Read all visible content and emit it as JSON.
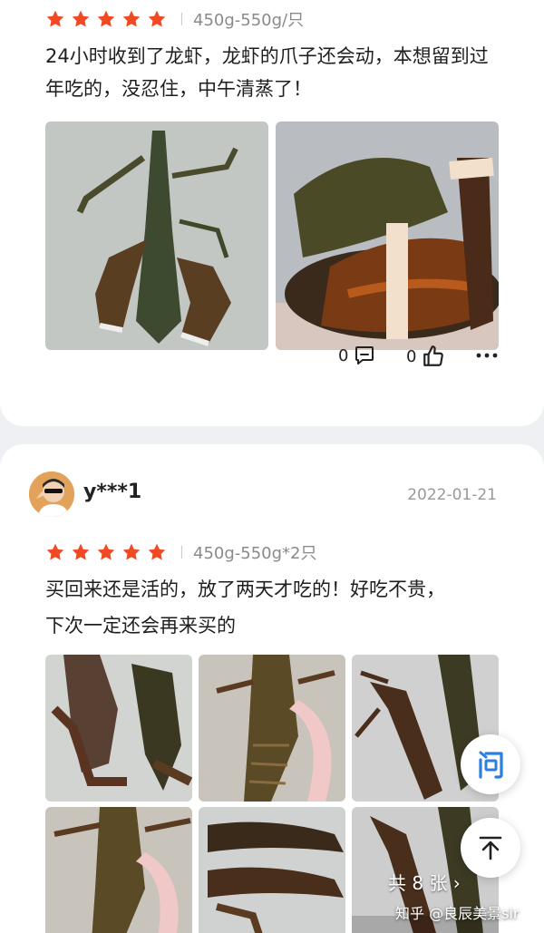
{
  "review1": {
    "rating": 5,
    "spec": "450g-550g/只",
    "text": "24小时收到了龙虾，龙虾的爪子还会动，本想留到过年吃的，没忍住，中午清蒸了！",
    "comment_count": "0",
    "like_count": "0"
  },
  "review2": {
    "username": "y***1",
    "date": "2022-01-21",
    "rating": 5,
    "spec": "450g-550g*2只",
    "text_line1": "买回来还是活的，放了两天才吃的！好吃不贵，",
    "text_line2": "下次一定还会再来买的",
    "photo_count": "共 8 张 ›"
  },
  "float": {
    "ask_icon": "问",
    "top_icon": "arrow-up-to-top-icon"
  },
  "watermark": "知乎 @良辰美景sir",
  "colors": {
    "star": "#f04a25",
    "bg": "#eef0f3",
    "ask_blue": "#2b7fe0"
  }
}
